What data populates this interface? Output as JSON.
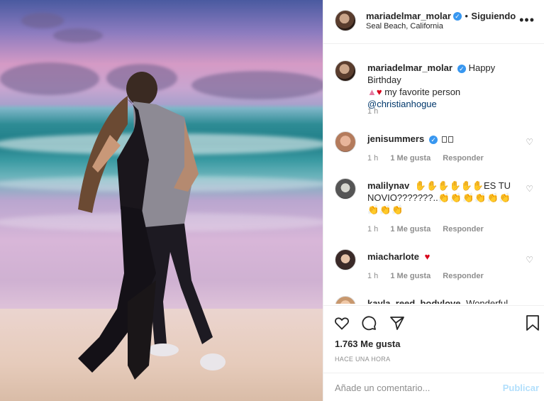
{
  "post": {
    "author": "mariadelmar_molar",
    "verified_mark": "✓",
    "separator": "•",
    "follow_label": "Siguiendo",
    "location": "Seal Beach, California",
    "more_icon": "more-horizontal-icon"
  },
  "caption": {
    "username": "mariadelmar_molar",
    "text": "Happy Birthday",
    "text2": "my favorite person",
    "mention": "@christianhogue",
    "time": "1 h"
  },
  "comments": [
    {
      "username": "jenisummers",
      "verified": true,
      "text": "",
      "time": "1 h",
      "likes": "1 Me gusta",
      "reply": "Responder"
    },
    {
      "username": "malilynav",
      "verified": false,
      "text": "ES TU NOVIO???????..",
      "time": "1 h",
      "likes": "1 Me gusta",
      "reply": "Responder"
    },
    {
      "username": "miacharlote",
      "verified": false,
      "text": "",
      "time": "1 h",
      "likes": "1 Me gusta",
      "reply": "Responder"
    },
    {
      "username": "kayla_reed_bodylove",
      "verified": false,
      "text": "Wonderful",
      "time": "",
      "likes": "",
      "reply": ""
    }
  ],
  "actions": {
    "likes_count": "1.763 Me gusta",
    "time_ago": "HACE UNA HORA",
    "comment_placeholder": "Añade un comentario...",
    "publish_label": "Publicar"
  },
  "colors": {
    "verified_blue": "#3897f0",
    "publish_disabled": "#b2dffc",
    "heart_red": "#d8001a"
  }
}
